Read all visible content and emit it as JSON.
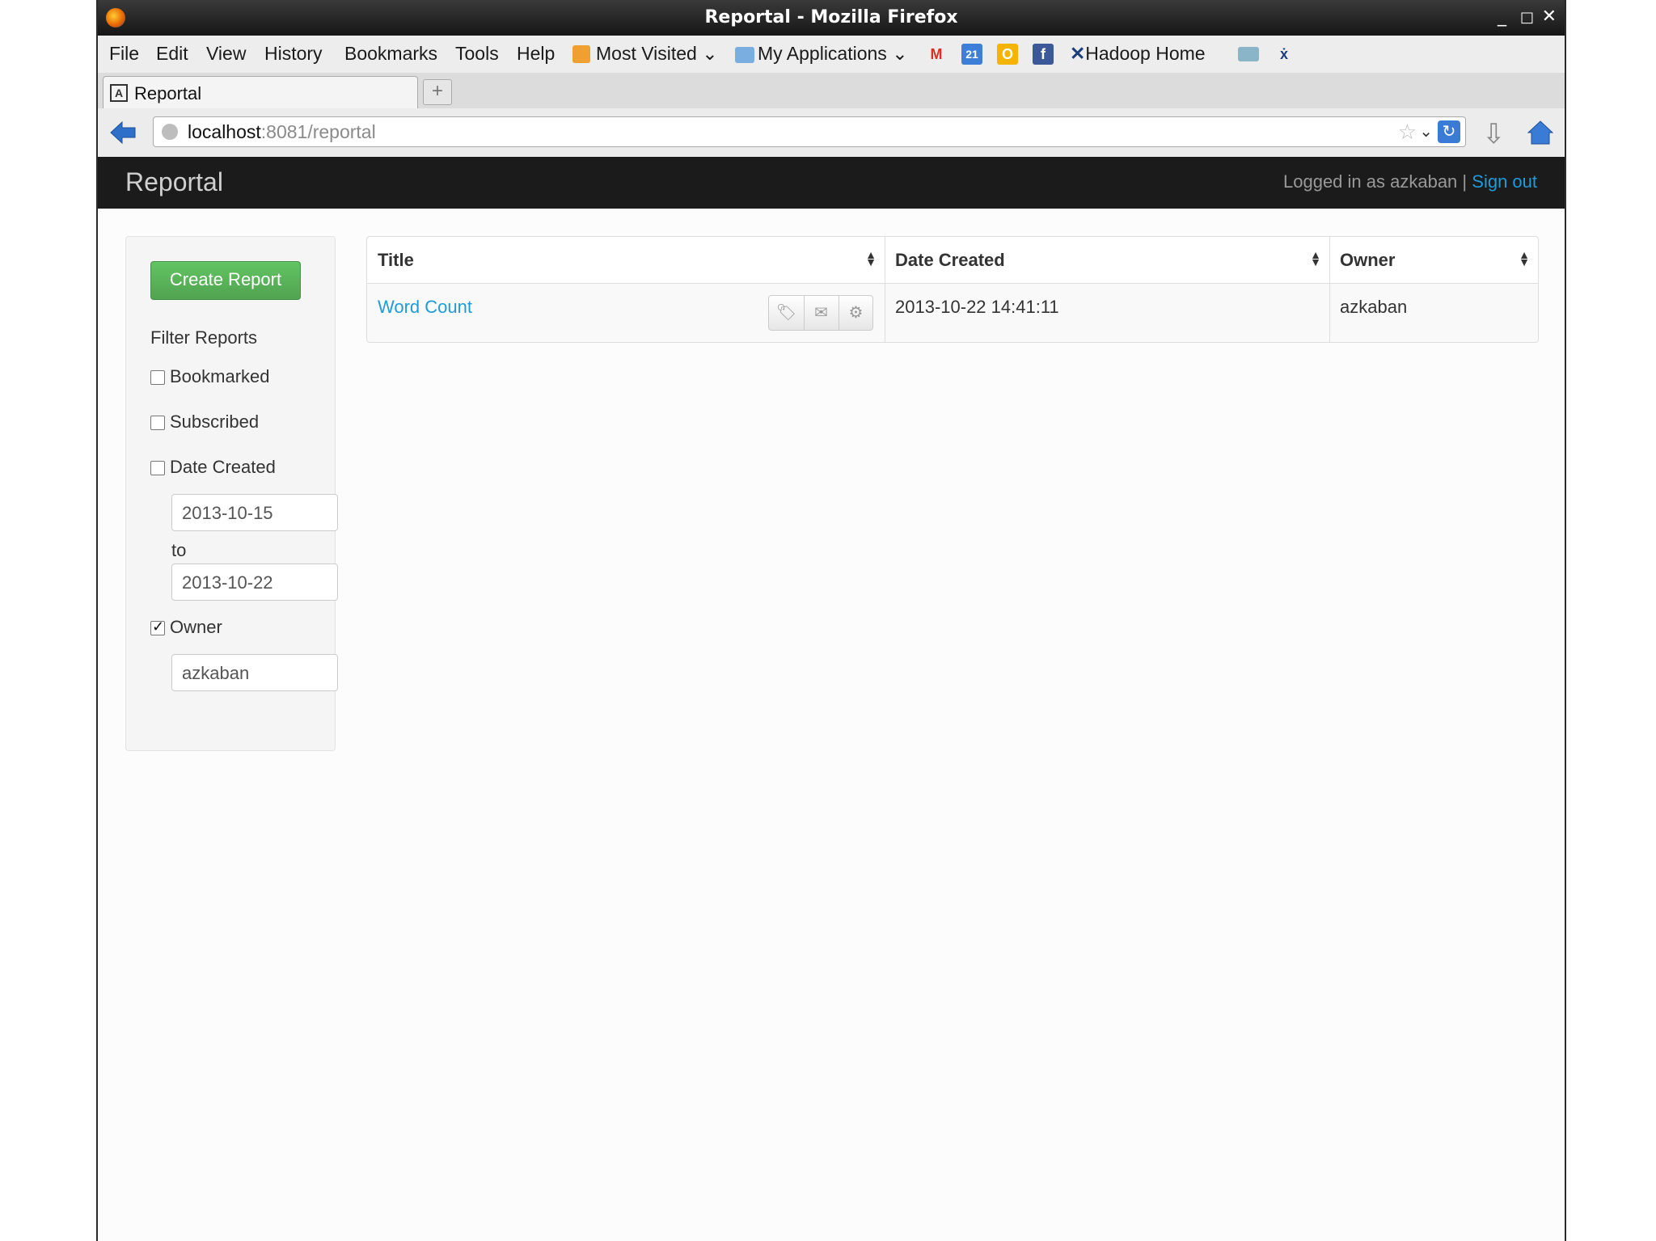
{
  "window": {
    "title": "Reportal - Mozilla Firefox"
  },
  "menubar": {
    "file": "File",
    "edit": "Edit",
    "view": "View",
    "history": "History",
    "bookmarks": "Bookmarks",
    "tools": "Tools",
    "help": "Help",
    "most_visited": "Most Visited",
    "my_applications": "My Applications",
    "hadoop_home": "Hadoop Home",
    "calendar_day": "21"
  },
  "tab": {
    "label": "Reportal"
  },
  "urlbar": {
    "host": "localhost",
    "rest": ":8081/reportal"
  },
  "app": {
    "brand": "Reportal",
    "logged_in_text": "Logged in as azkaban",
    "separator": "|",
    "sign_out": "Sign out"
  },
  "sidebar": {
    "create_button": "Create Report",
    "filter_heading": "Filter Reports",
    "bookmarked": "Bookmarked",
    "subscribed": "Subscribed",
    "date_created": "Date Created",
    "date_from": "2013-10-15",
    "to_label": "to",
    "date_to": "2013-10-22",
    "owner": "Owner",
    "owner_value": "azkaban",
    "checks": {
      "bookmarked": false,
      "subscribed": false,
      "date_created": false,
      "owner": true
    }
  },
  "table": {
    "headers": {
      "title": "Title",
      "date_created": "Date Created",
      "owner": "Owner"
    },
    "rows": [
      {
        "title": "Word Count",
        "date_created": "2013-10-22 14:41:11",
        "owner": "azkaban"
      }
    ]
  },
  "colors": {
    "link": "#1e9bd8",
    "create_button": "#51a351",
    "navbar": "#1b1b1b"
  }
}
